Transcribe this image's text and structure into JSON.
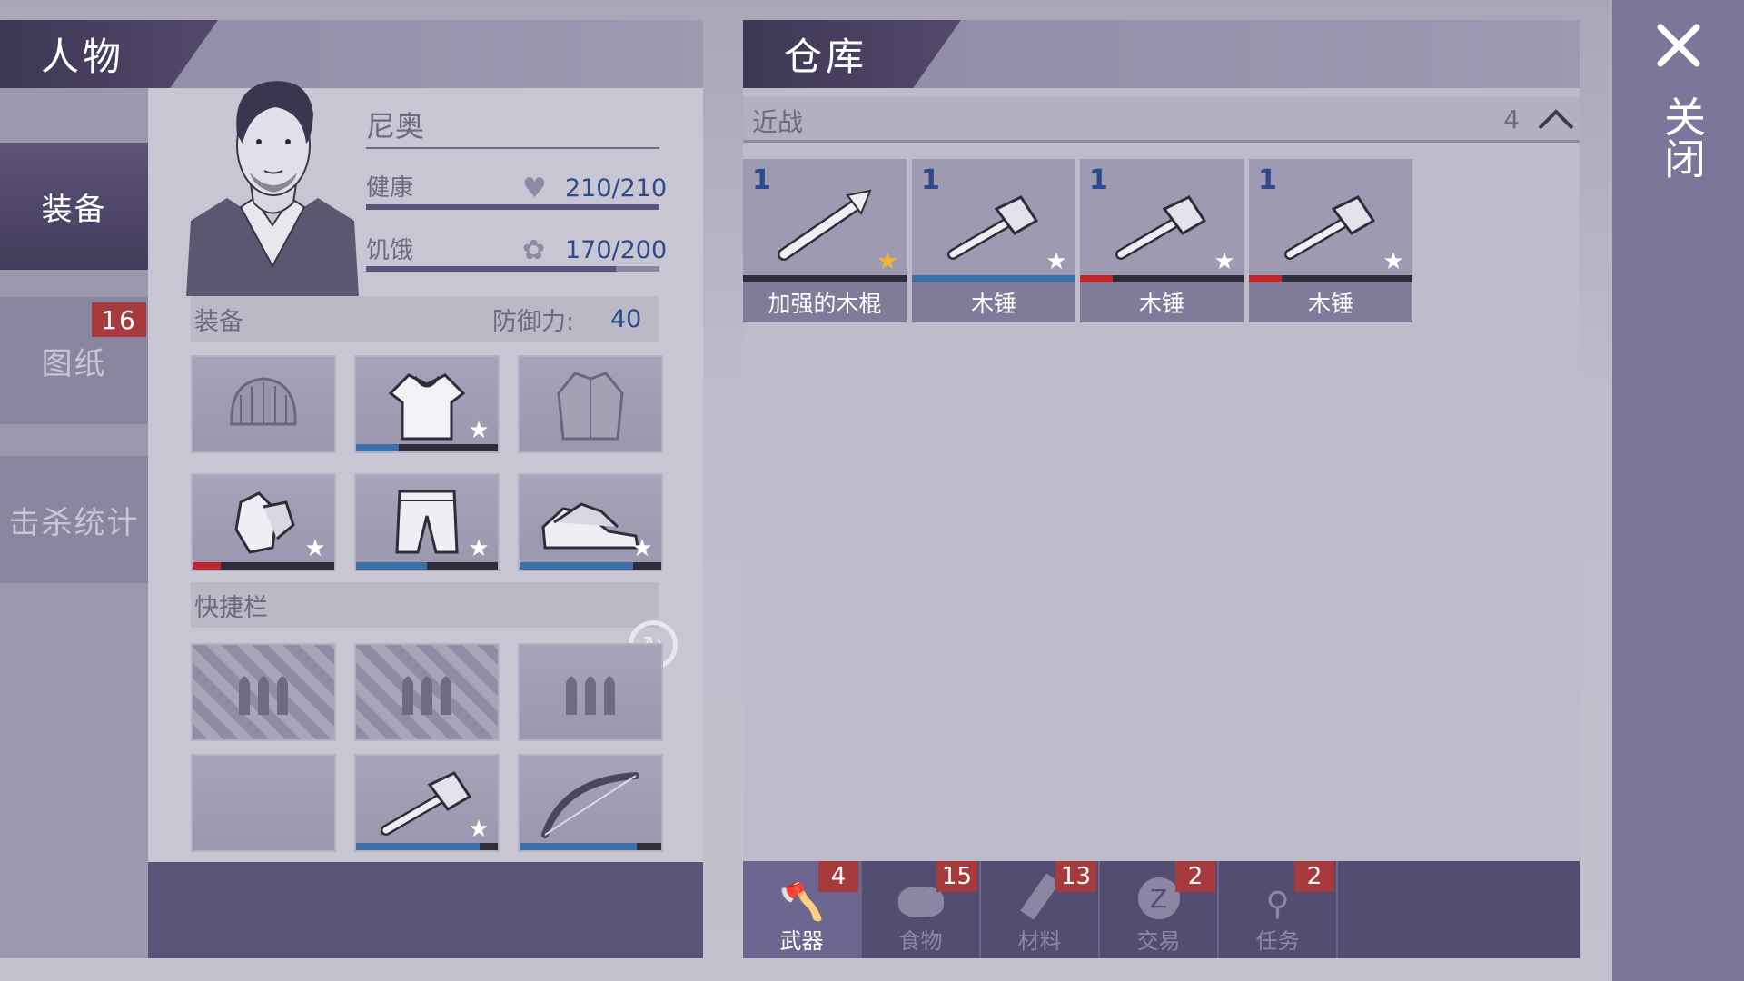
{
  "character_panel": {
    "title": "人物",
    "name": "尼奥",
    "health": {
      "label": "健康",
      "value": "210/210",
      "fraction": 1.0
    },
    "hunger": {
      "label": "饥饿",
      "value": "170/200",
      "fraction": 0.85
    },
    "equipment_header": {
      "label": "装备",
      "defense_label": "防御力:",
      "defense_value": "40"
    },
    "equipment_slots": [
      {
        "icon": "beanie-icon",
        "durability": null,
        "dur_color": "",
        "star": false
      },
      {
        "icon": "hoodie-icon",
        "durability": 0.3,
        "dur_color": "#3d6fa8",
        "star": true
      },
      {
        "icon": "jacket-icon",
        "durability": null,
        "dur_color": "",
        "star": false
      },
      {
        "icon": "gloves-icon",
        "durability": 0.2,
        "dur_color": "#c4242c",
        "star": true
      },
      {
        "icon": "pants-icon",
        "durability": 0.5,
        "dur_color": "#3d6fa8",
        "star": true
      },
      {
        "icon": "sneakers-icon",
        "durability": 0.8,
        "dur_color": "#3d6fa8",
        "star": true
      }
    ],
    "quickbar_header": "快捷栏",
    "quickbar_slots": [
      {
        "icon": "ammo-icon",
        "hatched": true,
        "durability": null
      },
      {
        "icon": "ammo-icon",
        "hatched": true,
        "durability": null
      },
      {
        "icon": "ammo-icon",
        "hatched": false,
        "durability": null
      },
      {
        "icon": "",
        "hatched": false,
        "durability": null
      },
      {
        "icon": "hammer-icon",
        "hatched": false,
        "durability": 0.87,
        "star": true
      },
      {
        "icon": "bow-icon",
        "hatched": false,
        "durability": 0.83,
        "star": false
      }
    ]
  },
  "nav": {
    "items": [
      {
        "label": "装备",
        "active": true
      },
      {
        "label": "图纸",
        "active": false,
        "badge": "16"
      },
      {
        "label": "击杀统计",
        "active": false
      }
    ]
  },
  "storage_panel": {
    "title": "仓库",
    "category": {
      "label": "近战",
      "count": "4"
    },
    "items": [
      {
        "count": "1",
        "name": "加强的木棍",
        "icon": "reinforced-stick-icon",
        "durability": null,
        "dur_color": "",
        "star": "gold"
      },
      {
        "count": "1",
        "name": "木锤",
        "icon": "wooden-hammer-icon",
        "durability": 1.0,
        "dur_color": "#3d6fa8",
        "star": "white"
      },
      {
        "count": "1",
        "name": "木锤",
        "icon": "wooden-hammer-icon",
        "durability": 0.2,
        "dur_color": "#c4242c",
        "star": "white"
      },
      {
        "count": "1",
        "name": "木锤",
        "icon": "wooden-hammer-icon",
        "durability": 0.2,
        "dur_color": "#c4242c",
        "star": "white"
      }
    ]
  },
  "bottom_tabs": [
    {
      "label": "武器",
      "badge": "4",
      "icon": "axe-icon",
      "active": true
    },
    {
      "label": "食物",
      "badge": "15",
      "icon": "meat-icon",
      "active": false
    },
    {
      "label": "材料",
      "badge": "13",
      "icon": "wood-log-icon",
      "active": false
    },
    {
      "label": "交易",
      "badge": "2",
      "icon": "trade-coin-icon",
      "active": false
    },
    {
      "label": "任务",
      "badge": "2",
      "icon": "key-icon",
      "active": false
    }
  ],
  "close": {
    "label": "关闭",
    "icon": "close-x-icon"
  }
}
